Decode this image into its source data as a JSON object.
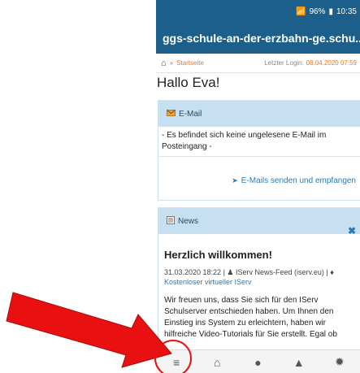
{
  "status": {
    "signal": "📶",
    "battery_pct": "96%",
    "battery_icon": "▮",
    "time": "10:35"
  },
  "titlebar": {
    "title": "ggs-schule-an-der-erzbahn-ge.schu..."
  },
  "breadcrumb": {
    "home_icon": "home-icon",
    "separator": "»",
    "current": "Startseite",
    "login_label": "Letzter Login:",
    "login_value": "08.04.2020 07:59"
  },
  "greeting": "Hallo Eva!",
  "mail": {
    "heading": "E-Mail",
    "message": "- Es befindet sich keine ungelesene E-Mail im Posteingang -",
    "send_link": "E-Mails senden und empfangen"
  },
  "news": {
    "heading": "News",
    "item_title": "Herzlich willkommen!",
    "meta_date": "31.03.2020 18:22 |",
    "meta_author": "IServ News-Feed (iserv.eu) |",
    "meta_link": "Kostenloser virtueller IServ",
    "body": "Wir freuen uns, dass Sie sich für den IServ Schulserver entschieden haben. Um Ihnen den Einstieg ins System zu erleichtern, haben wir hilfreiche Video-Tutorials für Sie erstellt. Egal ob"
  },
  "nav": {
    "menu": "≡",
    "home": "⌂",
    "chat": "●",
    "bell": "▲",
    "settings": "✹"
  },
  "colors": {
    "header": "#1c5f8a",
    "panel_head": "#c6e0f1",
    "link": "#2a7ab8",
    "accent": "#e8772e",
    "annotation": "#e81010"
  }
}
